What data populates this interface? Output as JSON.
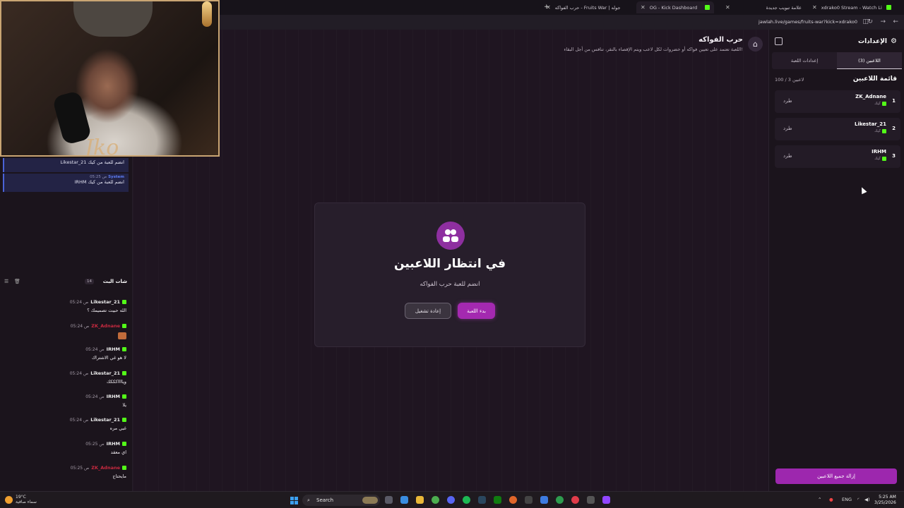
{
  "browser": {
    "tabs": [
      {
        "title": "حرب الفواكه - Fruits War | جوله",
        "active": true
      },
      {
        "title": "OG - Kick Dashboard",
        "active": false
      },
      {
        "title": "علامة تبويب جديدة",
        "active": false
      },
      {
        "title": "xdrako0 Stream - Watch Li",
        "active": false
      }
    ],
    "new_tab": "+",
    "url": "jawlah.live/games/fruits-war?kick=xdrako0"
  },
  "header": {
    "title": "حرب الفواكه",
    "description": "اللعبة تعتمد على تعيين فواكه أو خضروات لكل لاعب ويتم الإقصاء بالنقر، تنافس من أجل البقاء!"
  },
  "card": {
    "title": "في انتظار اللاعبين",
    "subtitle": "انضم للعبة حرب الفواكه",
    "start_label": "بدء اللعبة",
    "restart_label": "إعادة تشغيل"
  },
  "settings": {
    "title": "الإعدادات",
    "tab_players": "اللاعبين (3)",
    "tab_game_settings": "إعدادات اللعبة",
    "list_title": "قائمة اللاعبين",
    "count": "100 / 3 لاعبين",
    "kick_label": "طرد",
    "platform": "كيك",
    "players": [
      {
        "index": "1",
        "name": "ZK_Adnane"
      },
      {
        "index": "2",
        "name": "Likestar_21"
      },
      {
        "index": "3",
        "name": "IRHM"
      }
    ],
    "remove_all_label": "إزالة جميع اللاعبين"
  },
  "system_messages": [
    {
      "user": "Likestar_21",
      "text": "انضم للعبة من كيك",
      "time": "",
      "sender": ""
    },
    {
      "user": "IRHM",
      "text": "انضم للعبة من كيك",
      "time": "05:25 ص",
      "sender": "System"
    }
  ],
  "chat": {
    "title": "شات البث",
    "count": "14",
    "messages": [
      {
        "user": "Likestar_21",
        "time": "05:24 ص",
        "text": "الله حبيت تصميمك ؟",
        "red": false
      },
      {
        "user": "ZK_Adnane",
        "time": "05:24 ص",
        "text": "",
        "red": true,
        "emote": true
      },
      {
        "user": "IRHM",
        "time": "05:24 ص",
        "text": "لا هو غي الاشتراك",
        "red": false
      },
      {
        "user": "Likestar_21",
        "time": "05:24 ص",
        "text": "ويااااكككك",
        "red": false
      },
      {
        "user": "IRHM",
        "time": "05:24 ص",
        "text": "يلا",
        "red": false
      },
      {
        "user": "Likestar_21",
        "time": "05:24 ص",
        "text": "غبي مره",
        "red": false
      },
      {
        "user": "IRHM",
        "time": "05:25 ص",
        "text": "اي معقد",
        "red": false
      },
      {
        "user": "ZK_Adnane",
        "time": "05:25 ص",
        "text": "مايحتاج",
        "red": true
      }
    ]
  },
  "taskbar": {
    "weather_temp": "19°C",
    "weather_desc": "سماء صافية",
    "search": "Search",
    "lang": "ENG",
    "time": "5:25 AM",
    "date": "3/25/2026"
  },
  "colors": {
    "accent": "#a429b0",
    "kick_green": "#53fc18",
    "bg": "#1f1521"
  }
}
